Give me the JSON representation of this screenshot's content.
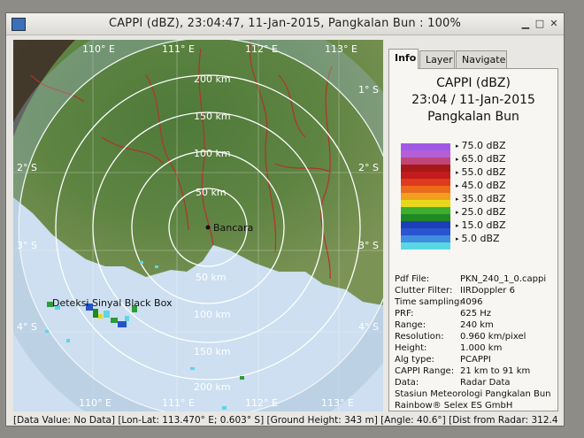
{
  "window": {
    "title": "CAPPI (dBZ), 23:04:47, 11-Jan-2015, Pangkalan Bun : 100%"
  },
  "tabs": [
    {
      "label": "Info",
      "active": true
    },
    {
      "label": "Layer",
      "active": false
    },
    {
      "label": "Navigate",
      "active": false
    }
  ],
  "info": {
    "product": "CAPPI (dBZ)",
    "datetime": "23:04 / 11-Jan-2015",
    "station": "Pangkalan Bun"
  },
  "legend": [
    {
      "label": "75.0 dBZ",
      "color": "#a05ae6"
    },
    {
      "label": "65.0 dBZ",
      "color": "#c04678"
    },
    {
      "label": "55.0 dBZ",
      "color": "#c21c1c"
    },
    {
      "label": "45.0 dBZ",
      "color": "#ec6a1c"
    },
    {
      "label": "35.0 dBZ",
      "color": "#e8d81a"
    },
    {
      "label": "25.0 dBZ",
      "color": "#1f8a24"
    },
    {
      "label": "15.0 dBZ",
      "color": "#2a54d0"
    },
    {
      "label": "5.0 dBZ",
      "color": "#5ad7e4"
    }
  ],
  "meta": [
    {
      "key": "Pdf File:",
      "value": "PKN_240_1_0.cappi"
    },
    {
      "key": "Clutter Filter:",
      "value": "IIRDoppler 6"
    },
    {
      "key": "Time sampling:",
      "value": "4096"
    },
    {
      "key": "PRF:",
      "value": "625 Hz"
    },
    {
      "key": "Range:",
      "value": "240 km"
    },
    {
      "key": "Resolution:",
      "value": "0.960 km/pixel"
    },
    {
      "key": "Height:",
      "value": "1.000 km"
    },
    {
      "key": "Alg type:",
      "value": "PCAPPI"
    },
    {
      "key": "CAPPI Range:",
      "value": "21 km to 91 km"
    },
    {
      "key": "Data:",
      "value": "Radar Data"
    }
  ],
  "footer": {
    "line1": "Stasiun Meteorologi Pangkalan Bun",
    "line2": "Rainbow® Selex ES GmbH"
  },
  "map": {
    "lon_top": [
      "110° E",
      "111° E",
      "112° E",
      "113° E"
    ],
    "lon_bottom": [
      "110° E",
      "111° E",
      "112° E",
      "113° E"
    ],
    "lat_left": [
      "2° S",
      "3° S",
      "4° S"
    ],
    "lat_right": [
      "1° S",
      "2° S",
      "3° S",
      "4° S"
    ],
    "ranges": [
      "50 km",
      "100 km",
      "150 km",
      "200 km"
    ],
    "ranges_south": [
      "50 km",
      "100 km",
      "150 km",
      "200 km"
    ],
    "station_label": "Bancara",
    "annotation": "Deteksi Sinyal Black Box"
  },
  "status": "[Data Value: No Data] [Lon-Lat: 113.470° E; 0.603° S] [Ground Height: 343 m] [Angle: 40.6°] [Dist from Radar: 312.4"
}
